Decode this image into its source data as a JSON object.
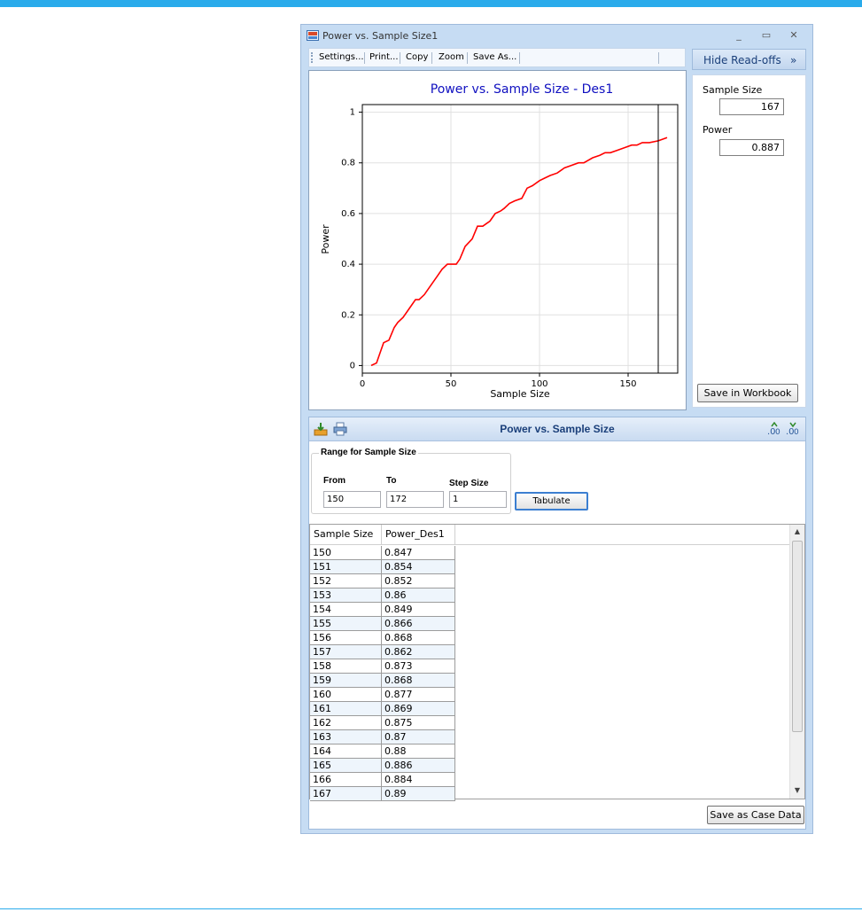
{
  "window": {
    "title": "Power vs. Sample Size1",
    "controls": {
      "minimize": "_",
      "maximize": "▭",
      "close": "✕"
    }
  },
  "toolbar": {
    "settings": "Settings...",
    "print": "Print...",
    "copy": "Copy",
    "zoom": "Zoom",
    "save_as": "Save As..."
  },
  "readoffs": {
    "toggle_label": "Hide Read-offs",
    "toggle_glyph": "»",
    "sample_size_label": "Sample Size",
    "sample_size_value": "167",
    "power_label": "Power",
    "power_value": "0.887",
    "save_button": "Save in Workbook"
  },
  "chart_data": {
    "type": "line",
    "title": "Power vs. Sample Size - Des1",
    "xlabel": "Sample Size",
    "ylabel": "Power",
    "xlim": [
      0,
      178
    ],
    "ylim": [
      -0.03,
      1.03
    ],
    "xticks": [
      0,
      50,
      100,
      150
    ],
    "yticks": [
      0,
      0.2,
      0.4,
      0.6,
      0.8,
      1
    ],
    "xtick_labels": [
      "0",
      "50",
      "100",
      "150"
    ],
    "ytick_labels": [
      "0",
      "0.2",
      "0.4",
      "0.6",
      "0.8",
      "1"
    ],
    "grid": true,
    "series": [
      {
        "color": "#ff0000",
        "x": [
          5,
          8,
          10,
          12,
          15,
          18,
          20,
          23,
          26,
          30,
          32,
          35,
          38,
          42,
          45,
          48,
          50,
          53,
          55,
          58,
          62,
          65,
          68,
          70,
          72,
          75,
          78,
          80,
          83,
          86,
          90,
          93,
          96,
          100,
          103,
          106,
          110,
          114,
          118,
          122,
          125,
          130,
          134,
          137,
          140,
          144,
          148,
          152,
          155,
          158,
          162,
          167,
          172
        ],
        "y": [
          0.0,
          0.01,
          0.05,
          0.09,
          0.1,
          0.15,
          0.17,
          0.19,
          0.22,
          0.26,
          0.26,
          0.28,
          0.31,
          0.35,
          0.38,
          0.4,
          0.4,
          0.4,
          0.42,
          0.47,
          0.5,
          0.55,
          0.55,
          0.56,
          0.57,
          0.6,
          0.61,
          0.62,
          0.64,
          0.65,
          0.66,
          0.7,
          0.71,
          0.73,
          0.74,
          0.75,
          0.76,
          0.78,
          0.79,
          0.8,
          0.8,
          0.82,
          0.83,
          0.84,
          0.84,
          0.85,
          0.86,
          0.87,
          0.87,
          0.88,
          0.88,
          0.887,
          0.9
        ]
      }
    ],
    "readoff_x": 167
  },
  "table_panel": {
    "title": "Power vs. Sample Size",
    "icons": [
      "export-icon",
      "print-icon",
      "increase-decimals-icon",
      "decrease-decimals-icon"
    ],
    "range_group_title": "Range for Sample Size",
    "from_label": "From",
    "to_label": "To",
    "step_label": "Step Size",
    "from_value": "150",
    "to_value": "172",
    "step_value": "1",
    "tabulate_button": "Tabulate",
    "columns": [
      "Sample Size",
      "Power_Des1"
    ],
    "rows": [
      [
        "150",
        "0.847"
      ],
      [
        "151",
        "0.854"
      ],
      [
        "152",
        "0.852"
      ],
      [
        "153",
        "0.86"
      ],
      [
        "154",
        "0.849"
      ],
      [
        "155",
        "0.866"
      ],
      [
        "156",
        "0.868"
      ],
      [
        "157",
        "0.862"
      ],
      [
        "158",
        "0.873"
      ],
      [
        "159",
        "0.868"
      ],
      [
        "160",
        "0.877"
      ],
      [
        "161",
        "0.869"
      ],
      [
        "162",
        "0.875"
      ],
      [
        "163",
        "0.87"
      ],
      [
        "164",
        "0.88"
      ],
      [
        "165",
        "0.886"
      ],
      [
        "166",
        "0.884"
      ],
      [
        "167",
        "0.89"
      ]
    ],
    "save_case_button": "Save as Case Data"
  },
  "colors": {
    "accent_bar": "#2aabeb",
    "window_frame": "#c6dcf3",
    "curve": "#ff0000",
    "chart_title": "#1010c0"
  }
}
